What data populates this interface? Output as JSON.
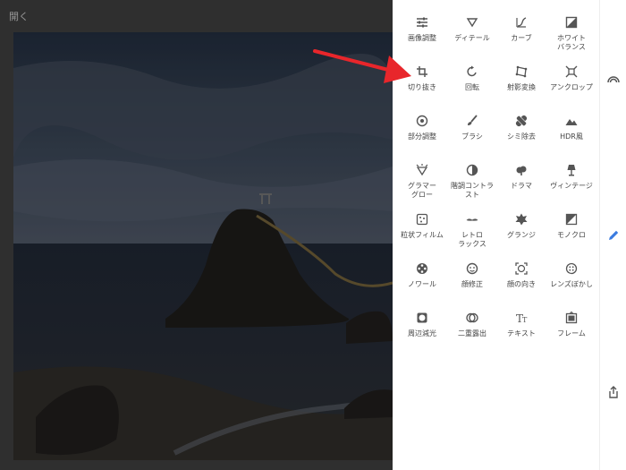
{
  "editor": {
    "open_label": "開く"
  },
  "tools": [
    {
      "label": "画像調整",
      "icon": "tune-icon"
    },
    {
      "label": "ディテール",
      "icon": "triangle-down-icon"
    },
    {
      "label": "カーブ",
      "icon": "curves-icon"
    },
    {
      "label": "ホワイト\nバランス",
      "icon": "white-balance-icon"
    },
    {
      "label": "切り抜き",
      "icon": "crop-icon"
    },
    {
      "label": "回転",
      "icon": "rotate-icon"
    },
    {
      "label": "射影変換",
      "icon": "perspective-icon"
    },
    {
      "label": "アンクロップ",
      "icon": "expand-icon"
    },
    {
      "label": "部分調整",
      "icon": "selective-icon"
    },
    {
      "label": "ブラシ",
      "icon": "brush-icon"
    },
    {
      "label": "シミ除去",
      "icon": "healing-icon"
    },
    {
      "label": "HDR風",
      "icon": "hdr-icon"
    },
    {
      "label": "グラマー\nグロー",
      "icon": "glamour-glow-icon"
    },
    {
      "label": "階調コントラ\nスト",
      "icon": "tonal-contrast-icon"
    },
    {
      "label": "ドラマ",
      "icon": "drama-icon"
    },
    {
      "label": "ヴィンテージ",
      "icon": "vintage-icon"
    },
    {
      "label": "粒状フィルム",
      "icon": "grainy-film-icon"
    },
    {
      "label": "レトロ\nラックス",
      "icon": "retrolux-icon"
    },
    {
      "label": "グランジ",
      "icon": "grunge-icon"
    },
    {
      "label": "モノクロ",
      "icon": "black-white-icon"
    },
    {
      "label": "ノワール",
      "icon": "noir-icon"
    },
    {
      "label": "顔修正",
      "icon": "face-enhance-icon"
    },
    {
      "label": "顔の向き",
      "icon": "head-pose-icon"
    },
    {
      "label": "レンズぼかし",
      "icon": "lens-blur-icon"
    },
    {
      "label": "周辺減光",
      "icon": "vignette-icon"
    },
    {
      "label": "二重露出",
      "icon": "double-exposure-icon"
    },
    {
      "label": "テキスト",
      "icon": "text-icon"
    },
    {
      "label": "フレーム",
      "icon": "frame-icon"
    }
  ],
  "rail": {
    "icons": [
      "looks-icon",
      "tools-pencil-icon",
      "export-icon"
    ]
  },
  "annotation": {
    "arrow_color": "#e8262b",
    "target": "切り抜き"
  }
}
